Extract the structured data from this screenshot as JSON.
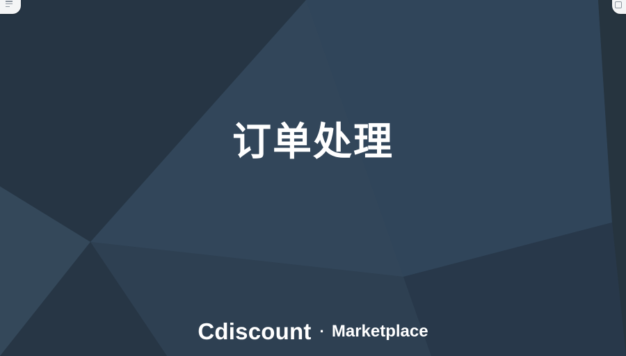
{
  "slide": {
    "title": "订单处理",
    "brand_name": "Cdiscount",
    "brand_separator": "·",
    "brand_sub": "Marketplace"
  },
  "controls": {
    "left_icon": "menu-icon",
    "right_icon": "square-icon"
  },
  "colors": {
    "background": "#2b3b4b",
    "facet_light": "#34485a",
    "facet_dark": "#24323f",
    "text": "#ffffff"
  }
}
